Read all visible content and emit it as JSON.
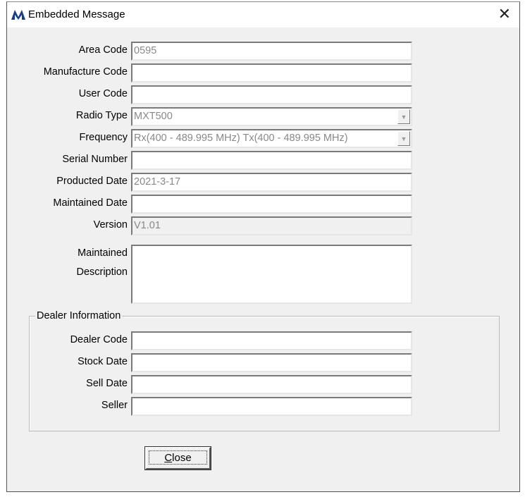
{
  "window": {
    "title": "Embedded Message",
    "close_glyph": "✕",
    "accent": "#1a3c8c"
  },
  "fields": [
    {
      "label": "Area Code",
      "value": "0595"
    },
    {
      "label": "Manufacture Code",
      "value": ""
    },
    {
      "label": "User Code",
      "value": ""
    },
    {
      "label": "Radio Type",
      "value": "MXT500"
    },
    {
      "label": "Frequency",
      "value": "Rx(400 - 489.995 MHz) Tx(400 - 489.995 MHz)"
    },
    {
      "label": "Serial Number",
      "value": ""
    },
    {
      "label": "Producted Date",
      "value": "2021-3-17"
    },
    {
      "label": "Maintained Date",
      "value": ""
    },
    {
      "label": "Version",
      "value": "V1.01"
    }
  ],
  "description": {
    "label1": "Maintained",
    "label2": "Description",
    "value": ""
  },
  "dealer": {
    "title": "Dealer Information",
    "fields": [
      {
        "label": "Dealer Code",
        "value": ""
      },
      {
        "label": "Stock Date",
        "value": ""
      },
      {
        "label": "Sell Date",
        "value": ""
      },
      {
        "label": "Seller",
        "value": ""
      }
    ]
  },
  "buttons": {
    "close_mnemonic": "C",
    "close_rest": "lose"
  },
  "icons": {
    "dropdown": "▼"
  }
}
